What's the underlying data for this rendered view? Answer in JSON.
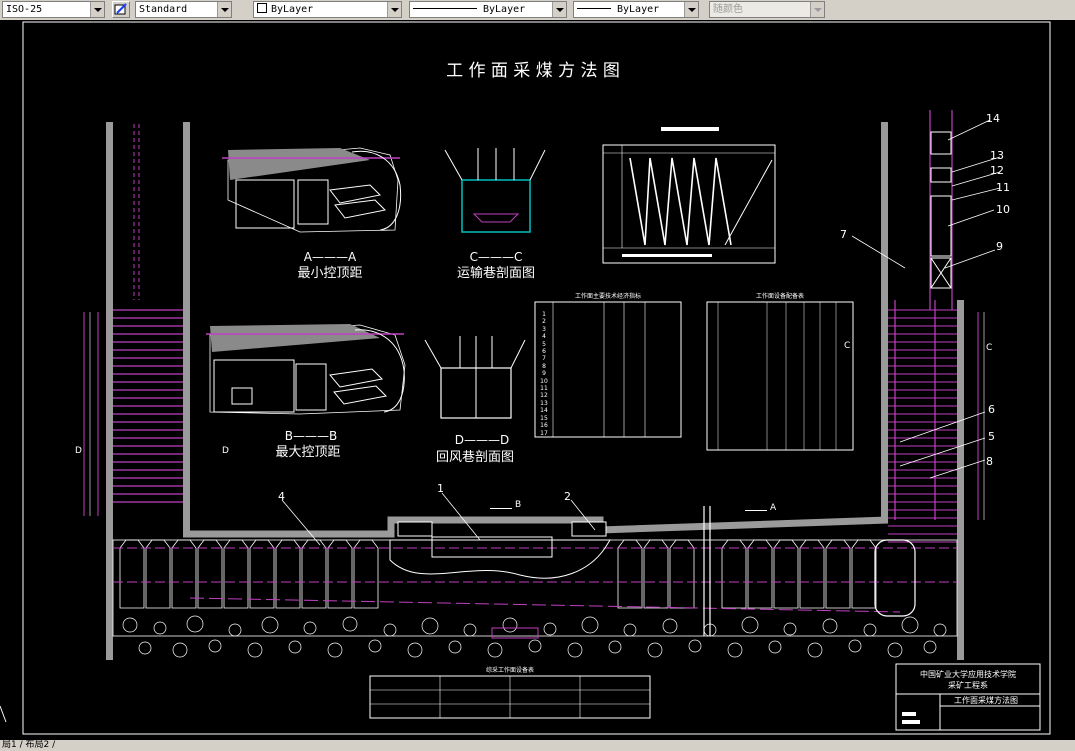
{
  "toolbar": {
    "dimstyle": "ISO-25",
    "textstyle": "Standard",
    "layer": "ByLayer",
    "linetype": "ByLayer",
    "lineweight": "ByLayer",
    "plotstyle": "随颜色"
  },
  "drawing": {
    "title": "工 作 面 采 煤 方 法 图",
    "views": {
      "min_section_mark": "A———A",
      "min_label": "最小控顶距",
      "max_section_mark": "B———B",
      "max_label": "最大控顶距",
      "haul_section_mark": "C———C",
      "haul_label": "运输巷剖面图",
      "return_section_mark": "D———D",
      "return_label": "回风巷剖面图"
    },
    "tables": {
      "params_title": "工作面主要技术经济指标",
      "equip_title": "工作面设备配备表",
      "bottom_title": "综采工作面设备表",
      "param_rows": [
        "1",
        "2",
        "3",
        "4",
        "5",
        "6",
        "7",
        "8",
        "9",
        "10",
        "11",
        "12",
        "13",
        "14",
        "15",
        "16",
        "17"
      ]
    },
    "callouts": [
      "1",
      "2",
      "4",
      "5",
      "6",
      "7",
      "8",
      "9",
      "10",
      "11",
      "12",
      "13",
      "14"
    ],
    "section_arrows": {
      "a": "A",
      "b": "B",
      "c": "C",
      "d": "D"
    },
    "title_block": {
      "school": "中国矿业大学应用技术学院",
      "dept": "采矿工程系",
      "drawing_name": "工作面采煤方法图"
    }
  },
  "tabs": {
    "label": "局1 / 布局2 /"
  }
}
